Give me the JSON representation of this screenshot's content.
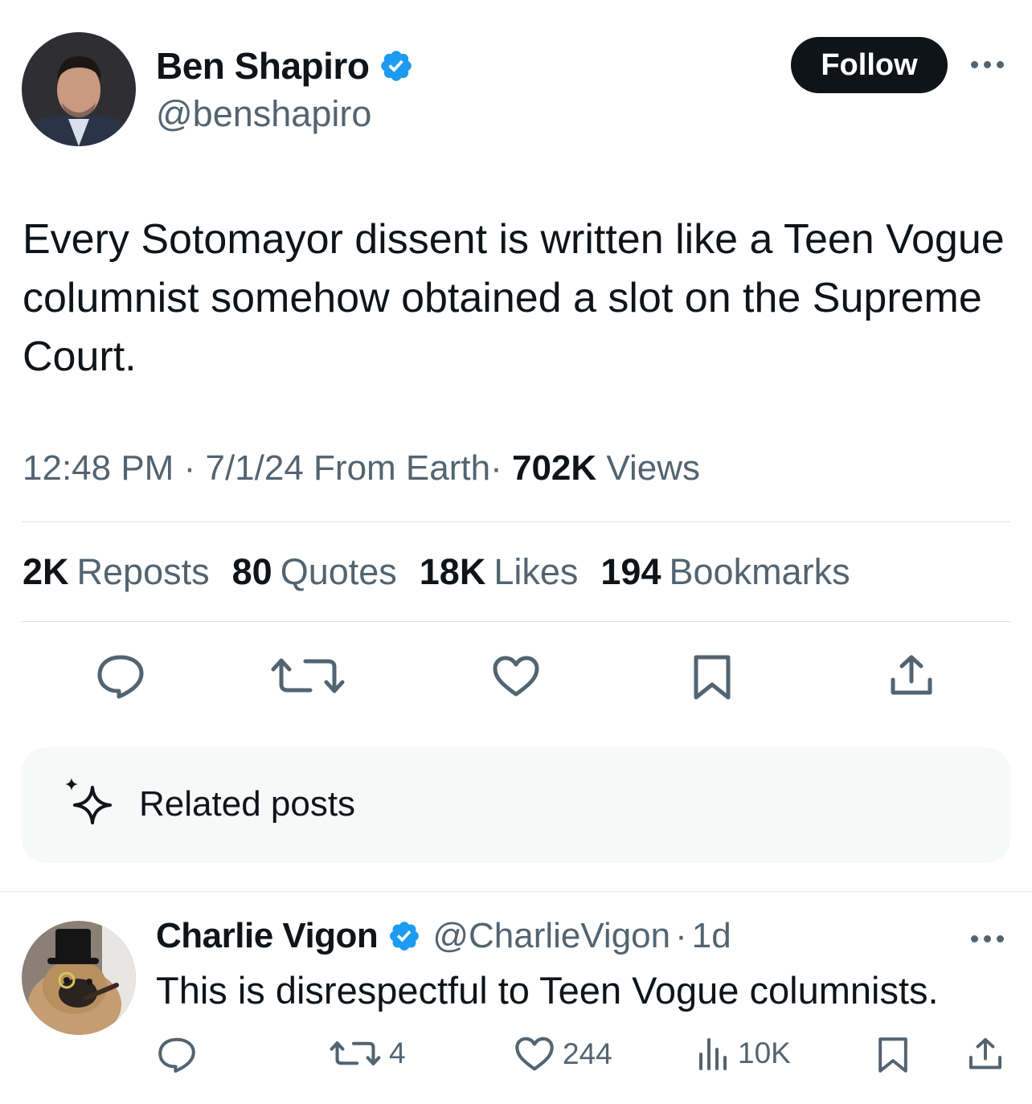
{
  "tweet": {
    "author_name": "Ben Shapiro",
    "author_handle": "@benshapiro",
    "follow_label": "Follow",
    "text": "Every Sotomayor dissent is written like a Teen Vogue columnist somehow obtained a slot on the Supreme Court.",
    "time": "12:48 PM",
    "date": "7/1/24",
    "location": "From Earth",
    "views_count": "702K",
    "views_label": "Views",
    "separator": "·"
  },
  "stats": [
    {
      "count": "2K",
      "label": "Reposts"
    },
    {
      "count": "80",
      "label": "Quotes"
    },
    {
      "count": "18K",
      "label": "Likes"
    },
    {
      "count": "194",
      "label": "Bookmarks"
    }
  ],
  "related": {
    "label": "Related posts"
  },
  "reply": {
    "author_name": "Charlie Vigon",
    "author_handle": "@CharlieVigon",
    "age": "1d",
    "separator": "·",
    "text": "This is disrespectful to Teen Vogue columnists.",
    "retweets": "4",
    "likes": "244",
    "views": "10K"
  },
  "colors": {
    "verified": "#1d9bf0",
    "text_primary": "#0f1419",
    "text_secondary": "#536471",
    "follow_bg": "#0f1419"
  },
  "icons": [
    "verified-badge-icon",
    "more-icon",
    "reply-icon",
    "retweet-icon",
    "like-icon",
    "bookmark-icon",
    "share-icon",
    "sparkle-icon",
    "views-icon"
  ]
}
